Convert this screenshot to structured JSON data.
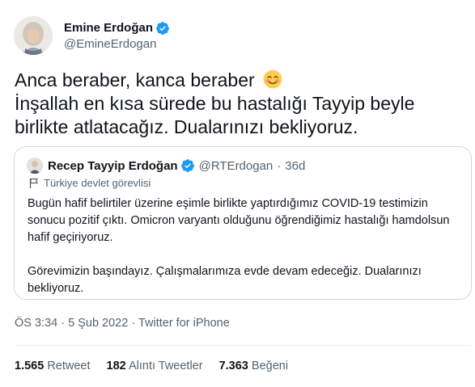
{
  "author": {
    "display_name": "Emine Erdoğan",
    "handle": "@EmineErdogan",
    "verified": true
  },
  "tweet": {
    "text": "Anca beraber, kanca beraber ",
    "text_rest": "İnşallah en kısa sürede bu hastalığı Tayyip beyle birlikte atlatacağız. Dualarınızı bekliyoruz.",
    "emoji": "smiling-face-icon"
  },
  "quoted": {
    "display_name": "Recep Tayyip Erdoğan",
    "handle": "@RTErdogan",
    "separator": "·",
    "age": "36d",
    "label": "Türkiye devlet görevlisi",
    "paragraph1": "Bugün hafif belirtiler üzerine eşimle birlikte yaptırdığımız COVID-19 testimizin sonucu pozitif çıktı. Omicron varyantı olduğunu öğrendiğimiz hastalığı hamdolsun hafif geçiriyoruz.",
    "paragraph2": "Görevimizin başındayız. Çalışmalarımıza evde devam edeceğiz. Dualarınızı bekliyoruz."
  },
  "meta": {
    "time": "ÖS 3:34",
    "date": "5 Şub 2022",
    "source": "Twitter for iPhone",
    "dot": "·"
  },
  "stats": {
    "retweets_count": "1.565",
    "retweets_label": "Retweet",
    "quotes_count": "182",
    "quotes_label": "Alıntı Tweetler",
    "likes_count": "7.363",
    "likes_label": "Beğeni"
  },
  "colors": {
    "verified": "#1d9bf0",
    "secondary_text": "#536471",
    "border": "#cfd9de"
  }
}
